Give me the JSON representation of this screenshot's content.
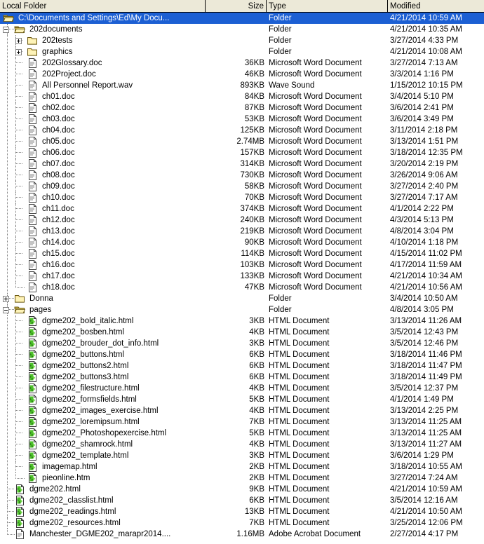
{
  "header": {
    "columns": [
      {
        "label": "Local Folder",
        "key": "name"
      },
      {
        "label": "Size",
        "key": "size"
      },
      {
        "label": "Type",
        "key": "type"
      },
      {
        "label": "Modified",
        "key": "modified"
      }
    ]
  },
  "colors": {
    "selection": "#1c5fd3",
    "header_bg": "#ece9d8",
    "body_bg": "#ffffff",
    "folder": "#ffe9a0",
    "html_icon": "#4ec22b",
    "guide": "#808080"
  },
  "rows": [
    {
      "name": "C:\\Documents and Settings\\Ed\\My Docu...",
      "size": "",
      "type": "Folder",
      "modified": "4/21/2014 10:59 AM",
      "depth": 0,
      "icon": "folder-open-icon",
      "expander": "none",
      "selected": true
    },
    {
      "name": "202documents",
      "size": "",
      "type": "Folder",
      "modified": "4/21/2014 10:35 AM",
      "depth": 1,
      "icon": "folder-open-icon",
      "expander": "minus",
      "selected": false
    },
    {
      "name": "202tests",
      "size": "",
      "type": "Folder",
      "modified": "3/27/2014 4:33 PM",
      "depth": 2,
      "icon": "folder-icon",
      "expander": "plus",
      "selected": false
    },
    {
      "name": "graphics",
      "size": "",
      "type": "Folder",
      "modified": "4/21/2014 10:08 AM",
      "depth": 2,
      "icon": "folder-icon",
      "expander": "plus",
      "selected": false
    },
    {
      "name": "202Glossary.doc",
      "size": "36KB",
      "type": "Microsoft Word Document",
      "modified": "3/27/2014 7:13 AM",
      "depth": 2,
      "icon": "document-icon",
      "expander": "none",
      "selected": false
    },
    {
      "name": "202Project.doc",
      "size": "46KB",
      "type": "Microsoft Word Document",
      "modified": "3/3/2014 1:16 PM",
      "depth": 2,
      "icon": "document-icon",
      "expander": "none",
      "selected": false
    },
    {
      "name": "All Personnel Report.wav",
      "size": "893KB",
      "type": "Wave Sound",
      "modified": "1/15/2012 10:15 PM",
      "depth": 2,
      "icon": "document-icon",
      "expander": "none",
      "selected": false
    },
    {
      "name": "ch01.doc",
      "size": "84KB",
      "type": "Microsoft Word Document",
      "modified": "3/4/2014 5:10 PM",
      "depth": 2,
      "icon": "document-icon",
      "expander": "none",
      "selected": false
    },
    {
      "name": "ch02.doc",
      "size": "87KB",
      "type": "Microsoft Word Document",
      "modified": "3/6/2014 2:41 PM",
      "depth": 2,
      "icon": "document-icon",
      "expander": "none",
      "selected": false
    },
    {
      "name": "ch03.doc",
      "size": "53KB",
      "type": "Microsoft Word Document",
      "modified": "3/6/2014 3:49 PM",
      "depth": 2,
      "icon": "document-icon",
      "expander": "none",
      "selected": false
    },
    {
      "name": "ch04.doc",
      "size": "125KB",
      "type": "Microsoft Word Document",
      "modified": "3/11/2014 2:18 PM",
      "depth": 2,
      "icon": "document-icon",
      "expander": "none",
      "selected": false
    },
    {
      "name": "ch05.doc",
      "size": "2.74MB",
      "type": "Microsoft Word Document",
      "modified": "3/13/2014 1:51 PM",
      "depth": 2,
      "icon": "document-icon",
      "expander": "none",
      "selected": false
    },
    {
      "name": "ch06.doc",
      "size": "157KB",
      "type": "Microsoft Word Document",
      "modified": "3/18/2014 12:35 PM",
      "depth": 2,
      "icon": "document-icon",
      "expander": "none",
      "selected": false
    },
    {
      "name": "ch07.doc",
      "size": "314KB",
      "type": "Microsoft Word Document",
      "modified": "3/20/2014 2:19 PM",
      "depth": 2,
      "icon": "document-icon",
      "expander": "none",
      "selected": false
    },
    {
      "name": "ch08.doc",
      "size": "730KB",
      "type": "Microsoft Word Document",
      "modified": "3/26/2014 9:06 AM",
      "depth": 2,
      "icon": "document-icon",
      "expander": "none",
      "selected": false
    },
    {
      "name": "ch09.doc",
      "size": "58KB",
      "type": "Microsoft Word Document",
      "modified": "3/27/2014 2:40 PM",
      "depth": 2,
      "icon": "document-icon",
      "expander": "none",
      "selected": false
    },
    {
      "name": "ch10.doc",
      "size": "70KB",
      "type": "Microsoft Word Document",
      "modified": "3/27/2014 7:17 AM",
      "depth": 2,
      "icon": "document-icon",
      "expander": "none",
      "selected": false
    },
    {
      "name": "ch11.doc",
      "size": "374KB",
      "type": "Microsoft Word Document",
      "modified": "4/1/2014 2:22 PM",
      "depth": 2,
      "icon": "document-icon",
      "expander": "none",
      "selected": false
    },
    {
      "name": "ch12.doc",
      "size": "240KB",
      "type": "Microsoft Word Document",
      "modified": "4/3/2014 5:13 PM",
      "depth": 2,
      "icon": "document-icon",
      "expander": "none",
      "selected": false
    },
    {
      "name": "ch13.doc",
      "size": "219KB",
      "type": "Microsoft Word Document",
      "modified": "4/8/2014 3:04 PM",
      "depth": 2,
      "icon": "document-icon",
      "expander": "none",
      "selected": false
    },
    {
      "name": "ch14.doc",
      "size": "90KB",
      "type": "Microsoft Word Document",
      "modified": "4/10/2014 1:18 PM",
      "depth": 2,
      "icon": "document-icon",
      "expander": "none",
      "selected": false
    },
    {
      "name": "ch15.doc",
      "size": "114KB",
      "type": "Microsoft Word Document",
      "modified": "4/15/2014 11:02 PM",
      "depth": 2,
      "icon": "document-icon",
      "expander": "none",
      "selected": false
    },
    {
      "name": "ch16.doc",
      "size": "103KB",
      "type": "Microsoft Word Document",
      "modified": "4/17/2014 11:59 AM",
      "depth": 2,
      "icon": "document-icon",
      "expander": "none",
      "selected": false
    },
    {
      "name": "ch17.doc",
      "size": "133KB",
      "type": "Microsoft Word Document",
      "modified": "4/21/2014 10:34 AM",
      "depth": 2,
      "icon": "document-icon",
      "expander": "none",
      "selected": false
    },
    {
      "name": "ch18.doc",
      "size": "47KB",
      "type": "Microsoft Word Document",
      "modified": "4/21/2014 10:56 AM",
      "depth": 2,
      "icon": "document-icon",
      "expander": "none",
      "selected": false
    },
    {
      "name": "Donna",
      "size": "",
      "type": "Folder",
      "modified": "3/4/2014 10:50 AM",
      "depth": 1,
      "icon": "folder-icon",
      "expander": "plus",
      "selected": false
    },
    {
      "name": "pages",
      "size": "",
      "type": "Folder",
      "modified": "4/8/2014 3:05 PM",
      "depth": 1,
      "icon": "folder-open-icon",
      "expander": "minus",
      "selected": false
    },
    {
      "name": "dgme202_bold_italic.html",
      "size": "3KB",
      "type": "HTML Document",
      "modified": "3/13/2014 11:26 AM",
      "depth": 2,
      "icon": "html-icon",
      "expander": "none",
      "selected": false
    },
    {
      "name": "dgme202_bosben.html",
      "size": "4KB",
      "type": "HTML Document",
      "modified": "3/5/2014 12:43 PM",
      "depth": 2,
      "icon": "html-icon",
      "expander": "none",
      "selected": false
    },
    {
      "name": "dgme202_brouder_dot_info.html",
      "size": "3KB",
      "type": "HTML Document",
      "modified": "3/5/2014 12:46 PM",
      "depth": 2,
      "icon": "html-icon",
      "expander": "none",
      "selected": false
    },
    {
      "name": "dgme202_buttons.html",
      "size": "6KB",
      "type": "HTML Document",
      "modified": "3/18/2014 11:46 PM",
      "depth": 2,
      "icon": "html-icon",
      "expander": "none",
      "selected": false
    },
    {
      "name": "dgme202_buttons2.html",
      "size": "6KB",
      "type": "HTML Document",
      "modified": "3/18/2014 11:47 PM",
      "depth": 2,
      "icon": "html-icon",
      "expander": "none",
      "selected": false
    },
    {
      "name": "dgme202_buttons3.html",
      "size": "6KB",
      "type": "HTML Document",
      "modified": "3/18/2014 11:49 PM",
      "depth": 2,
      "icon": "html-icon",
      "expander": "none",
      "selected": false
    },
    {
      "name": "dgme202_filestructure.html",
      "size": "4KB",
      "type": "HTML Document",
      "modified": "3/5/2014 12:37 PM",
      "depth": 2,
      "icon": "html-icon",
      "expander": "none",
      "selected": false
    },
    {
      "name": "dgme202_formsfields.html",
      "size": "5KB",
      "type": "HTML Document",
      "modified": "4/1/2014 1:49 PM",
      "depth": 2,
      "icon": "html-icon",
      "expander": "none",
      "selected": false
    },
    {
      "name": "dgme202_images_exercise.html",
      "size": "4KB",
      "type": "HTML Document",
      "modified": "3/13/2014 2:25 PM",
      "depth": 2,
      "icon": "html-icon",
      "expander": "none",
      "selected": false
    },
    {
      "name": "dgme202_loremipsum.html",
      "size": "7KB",
      "type": "HTML Document",
      "modified": "3/13/2014 11:25 AM",
      "depth": 2,
      "icon": "html-icon",
      "expander": "none",
      "selected": false
    },
    {
      "name": "dgme202_Photoshopexercise.html",
      "size": "5KB",
      "type": "HTML Document",
      "modified": "3/13/2014 11:25 AM",
      "depth": 2,
      "icon": "html-icon",
      "expander": "none",
      "selected": false
    },
    {
      "name": "dgme202_shamrock.html",
      "size": "4KB",
      "type": "HTML Document",
      "modified": "3/13/2014 11:27 AM",
      "depth": 2,
      "icon": "html-icon",
      "expander": "none",
      "selected": false
    },
    {
      "name": "dgme202_template.html",
      "size": "3KB",
      "type": "HTML Document",
      "modified": "3/6/2014 1:29 PM",
      "depth": 2,
      "icon": "html-icon",
      "expander": "none",
      "selected": false
    },
    {
      "name": "imagemap.html",
      "size": "2KB",
      "type": "HTML Document",
      "modified": "3/18/2014 10:55 AM",
      "depth": 2,
      "icon": "html-icon",
      "expander": "none",
      "selected": false
    },
    {
      "name": "pieonline.htm",
      "size": "2KB",
      "type": "HTML Document",
      "modified": "3/27/2014 7:24 AM",
      "depth": 2,
      "icon": "html-icon",
      "expander": "none",
      "selected": false
    },
    {
      "name": "dgme202.html",
      "size": "9KB",
      "type": "HTML Document",
      "modified": "4/21/2014 10:59 AM",
      "depth": 1,
      "icon": "html-icon",
      "expander": "none",
      "selected": false
    },
    {
      "name": "dgme202_classlist.html",
      "size": "6KB",
      "type": "HTML Document",
      "modified": "3/5/2014 12:16 AM",
      "depth": 1,
      "icon": "html-icon",
      "expander": "none",
      "selected": false
    },
    {
      "name": "dgme202_readings.html",
      "size": "13KB",
      "type": "HTML Document",
      "modified": "4/21/2014 10:50 AM",
      "depth": 1,
      "icon": "html-icon",
      "expander": "none",
      "selected": false
    },
    {
      "name": "dgme202_resources.html",
      "size": "7KB",
      "type": "HTML Document",
      "modified": "3/25/2014 12:06 PM",
      "depth": 1,
      "icon": "html-icon",
      "expander": "none",
      "selected": false
    },
    {
      "name": "Manchester_DGME202_marapr2014....",
      "size": "1.16MB",
      "type": "Adobe Acrobat Document",
      "modified": "2/27/2014 4:17 PM",
      "depth": 1,
      "icon": "document-icon",
      "expander": "none",
      "selected": false
    }
  ]
}
